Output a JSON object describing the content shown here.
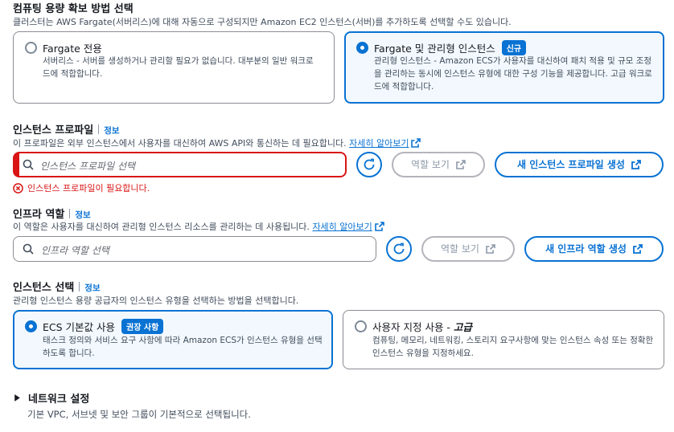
{
  "capacity": {
    "title": "컴퓨팅 용량 확보 방법 선택",
    "description": "클러스터는 AWS Fargate(서버리스)에 대해 자동으로 구성되지만 Amazon EC2 인스턴스(서버)를 추가하도록 선택할 수도 있습니다.",
    "options": [
      {
        "title": "Fargate 전용",
        "description": "서버리스 - 서버를 생성하거나 관리할 필요가 없습니다. 대부분의 일반 워크로드에 적합합니다.",
        "selected": false
      },
      {
        "title": "Fargate 및 관리형 인스턴스",
        "badge": "신규",
        "description": "관리형 인스턴스 - Amazon ECS가 사용자를 대신하여 패치 적용 및 규모 조정을 관리하는 동시에 인스턴스 유형에 대한 구성 기능을 제공합니다. 고급 워크로드에 적합합니다.",
        "selected": true
      }
    ]
  },
  "instance_profile": {
    "title": "인스턴스 프로파일",
    "info": "정보",
    "description": "이 프로파일은 외부 인스턴스에서 사용자를 대신하여 AWS API와 통신하는 데 필요합니다.",
    "learn_more": "자세히 알아보기",
    "placeholder": "인스턴스 프로파일 선택",
    "view_role": "역할 보기",
    "create": "새 인스턴스 프로파일 생성",
    "error": "인스턴스 프로파일이 필요합니다."
  },
  "infra_role": {
    "title": "인프라 역할",
    "info": "정보",
    "description": "이 역할은 사용자를 대신하여 관리형 인스턴스 리소스를 관리하는 데 사용됩니다.",
    "learn_more": "자세히 알아보기",
    "placeholder": "인프라 역할 선택",
    "view_role": "역할 보기",
    "create": "새 인프라 역할 생성"
  },
  "instance_selection": {
    "title": "인스턴스 선택",
    "info": "정보",
    "description": "관리형 인스턴스 용량 공급자의 인스턴스 유형을 선택하는 방법을 선택합니다.",
    "options": [
      {
        "title": "ECS 기본값 사용",
        "badge": "권장 사항",
        "description": "태스크 정의와 서비스 요구 사항에 따라 Amazon ECS가 인스턴스 유형을 선택하도록 합니다.",
        "selected": true
      },
      {
        "title_prefix": "사용자 지정 사용 - ",
        "title_em": "고급",
        "description": "컴퓨팅, 메모리, 네트워킹, 스토리지 요구사항에 맞는 인스턴스 속성 또는 정확한 인스턴스 유형을 지정하세요.",
        "selected": false
      }
    ]
  },
  "network": {
    "title": "네트워크 설정",
    "description": "기본 VPC, 서브넷 및 보안 그룹이 기본적으로 선택됩니다."
  }
}
